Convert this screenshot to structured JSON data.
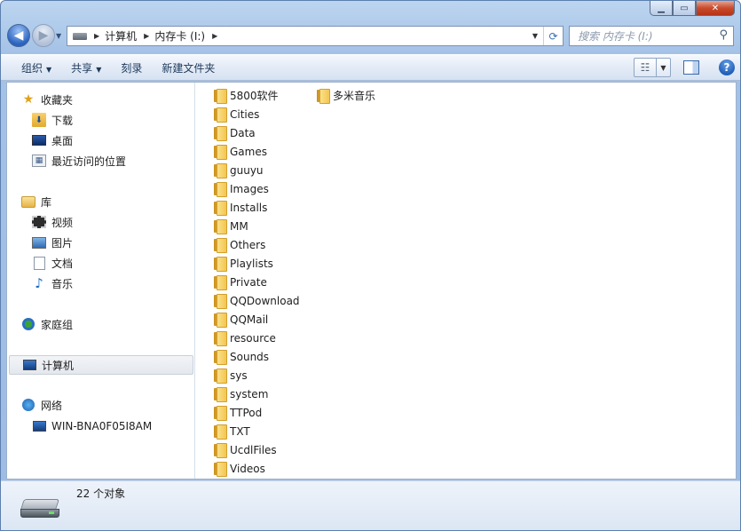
{
  "window": {
    "caption_buttons": [
      "minimize",
      "maximize",
      "close"
    ]
  },
  "address_bar": {
    "breadcrumbs": [
      "计算机",
      "内存卡 (I:)"
    ],
    "search_placeholder": "搜索 内存卡 (I:)"
  },
  "toolbar": {
    "organize": "组织",
    "share": "共享",
    "burn": "刻录",
    "new_folder": "新建文件夹"
  },
  "sidebar": {
    "favorites": {
      "label": "收藏夹",
      "items": [
        "下载",
        "桌面",
        "最近访问的位置"
      ]
    },
    "libraries": {
      "label": "库",
      "items": [
        "视频",
        "图片",
        "文档",
        "音乐"
      ]
    },
    "homegroup": "家庭组",
    "computer": "计算机",
    "network": {
      "label": "网络",
      "items": [
        "WIN-BNA0F05I8AM"
      ]
    }
  },
  "files": {
    "column1": [
      "5800软件",
      "Cities",
      "Data",
      "Games",
      "guuyu",
      "Images",
      "Installs",
      "MM",
      "Others",
      "Playlists",
      "Private",
      "QQDownload",
      "QQMail",
      "resource",
      "Sounds",
      "sys",
      "system",
      "TTPod",
      "TXT",
      "UcdlFiles",
      "Videos"
    ],
    "column2": [
      "多米音乐"
    ]
  },
  "status": {
    "count_text": "22 个对象"
  }
}
